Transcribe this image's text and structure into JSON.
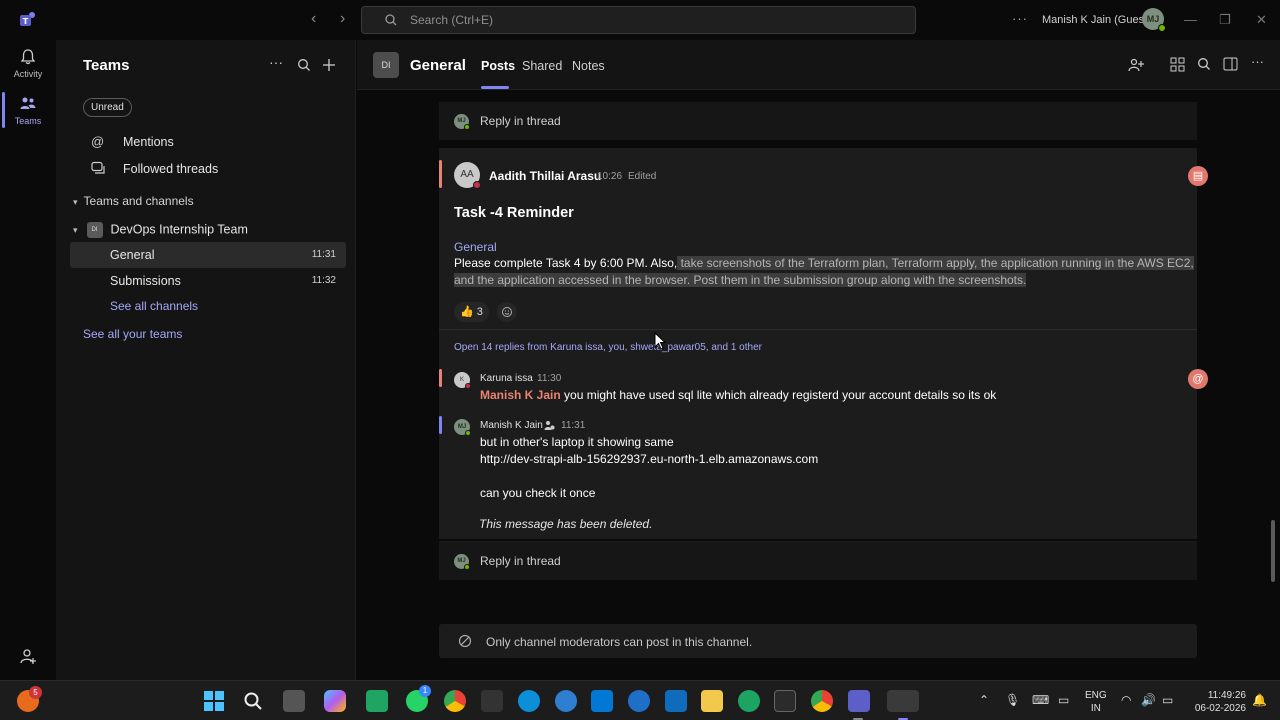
{
  "titlebar": {
    "search_placeholder": "Search (Ctrl+E)",
    "more": "···",
    "user_name": "Manish K Jain (Guest)",
    "user_initials": "MJ"
  },
  "rail": {
    "items": [
      {
        "label": "Activity",
        "icon": "bell-icon"
      },
      {
        "label": "Teams",
        "icon": "teams-icon"
      }
    ]
  },
  "left": {
    "title": "Teams",
    "unread": "Unread",
    "mentions": "Mentions",
    "followed": "Followed threads",
    "section": "Teams and channels",
    "team_name": "DevOps Internship Team",
    "team_initials": "DI",
    "channels": [
      {
        "name": "General",
        "time": "11:31"
      },
      {
        "name": "Submissions",
        "time": "11:32"
      }
    ],
    "see_all_channels": "See all channels",
    "see_all_teams": "See all your teams"
  },
  "header": {
    "channel_initials": "DI",
    "channel": "General",
    "tabs": [
      "Posts",
      "Shared",
      "Notes"
    ]
  },
  "thread": {
    "reply": "Reply in thread",
    "post": {
      "initials": "AA",
      "author": "Aadith Thillai Arasu",
      "time": "10:26",
      "edited": "Edited",
      "title": "Task -4 Reminder",
      "channel_ref": "General",
      "line1_plain": "Please complete Task 4 by 6:00 PM. Also,",
      "line1_hl": " take screenshots of the Terraform plan, Terraform apply, the application running in the AWS EC2,",
      "line2_hl": "and the application accessed in the browser. Post them in the submission group along with the screenshots.",
      "reaction_emoji": "👍",
      "reaction_count": "3"
    },
    "open_replies": "Open 14 replies from Karuna issa, you, shweta_pawar05, and 1 other",
    "replies": [
      {
        "initials": "K",
        "name": "Karuna issa",
        "time": "11:30",
        "mention": "Manish K Jain",
        "text": " you might have used sql lite which already registerd your account details so its ok"
      },
      {
        "initials": "MJ",
        "name": "Manish K Jain",
        "time": "11:31",
        "line1": "but in other's laptop it showing same",
        "line2": "http://dev-strapi-alb-156292937.eu-north-1.elb.amazonaws.com",
        "line3": "can you check it once",
        "deleted": "This message has been deleted."
      }
    ],
    "moderators_only": "Only channel moderators can post in this channel."
  },
  "taskbar": {
    "notif_count": "5",
    "whatsapp_badge": "1",
    "lang_top": "ENG",
    "lang_bottom": "IN",
    "time": "11:49:26",
    "date": "06-02-2026"
  }
}
